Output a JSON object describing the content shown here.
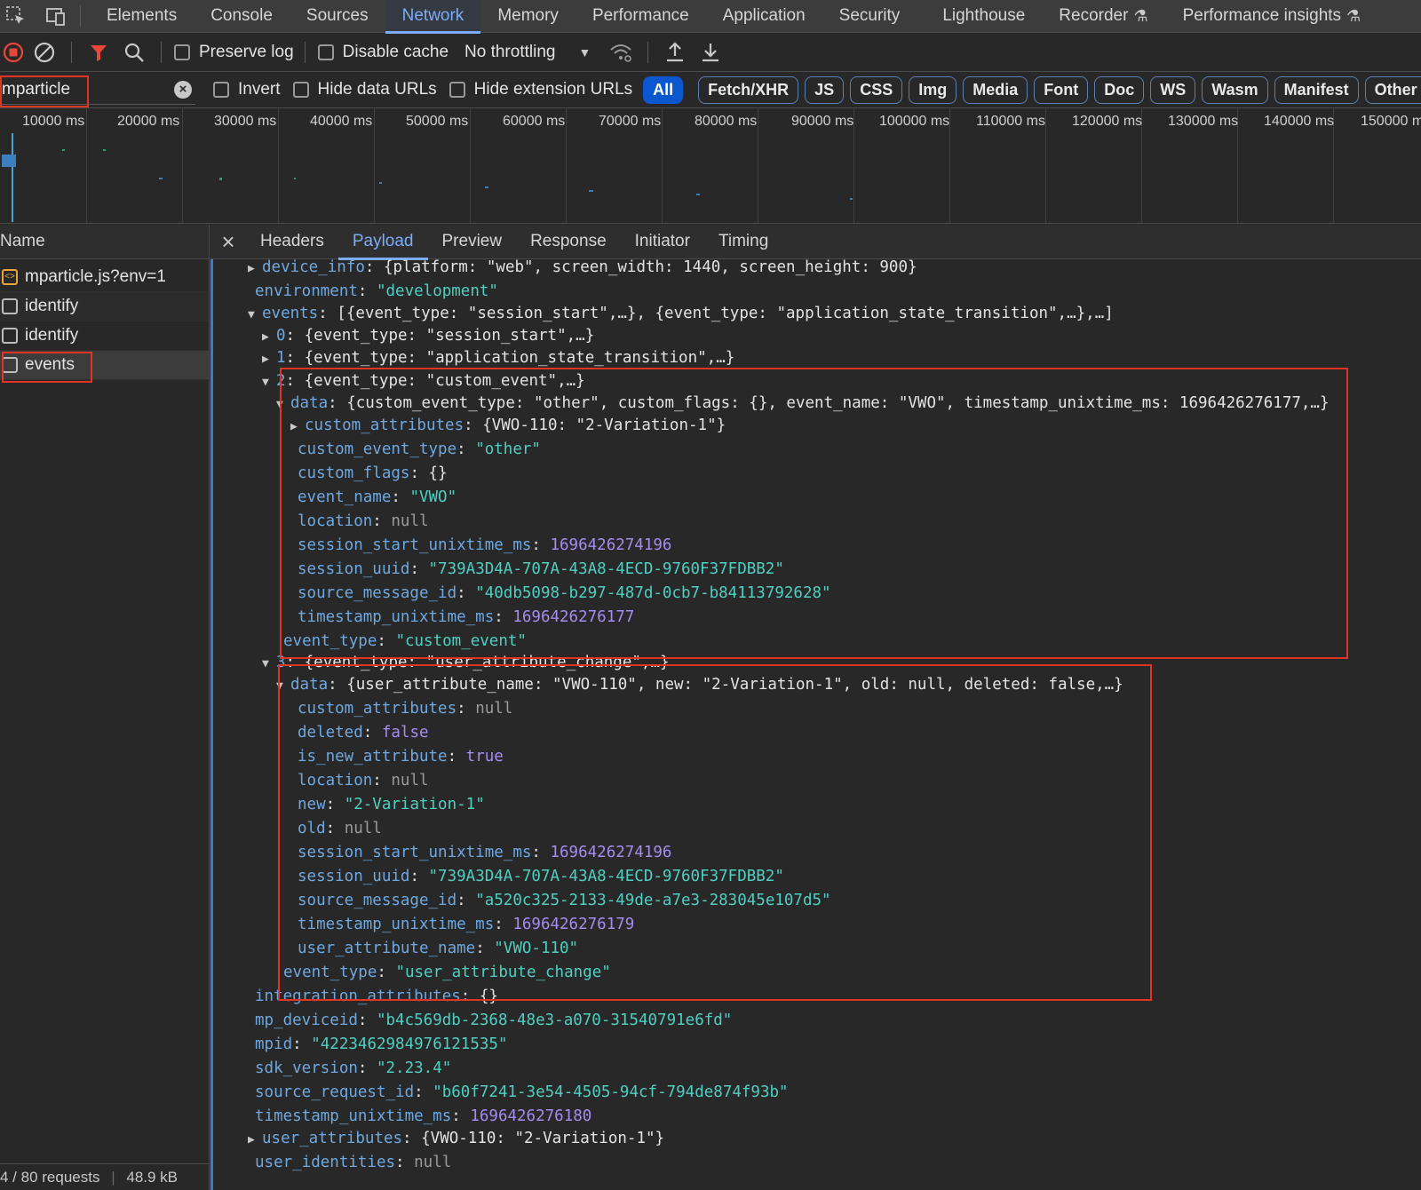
{
  "tabs": [
    "Elements",
    "Console",
    "Sources",
    "Network",
    "Memory",
    "Performance",
    "Application",
    "Security",
    "Lighthouse",
    "Recorder",
    "Performance insights"
  ],
  "toolbar": {
    "preserve_log": "Preserve log",
    "disable_cache": "Disable cache",
    "throttling": "No throttling"
  },
  "filter": {
    "value": "mparticle",
    "invert": "Invert",
    "hide_data_urls": "Hide data URLs",
    "hide_extension_urls": "Hide extension URLs",
    "types": [
      "All",
      "Fetch/XHR",
      "JS",
      "CSS",
      "Img",
      "Media",
      "Font",
      "Doc",
      "WS",
      "Wasm",
      "Manifest",
      "Other"
    ]
  },
  "timeline": {
    "labels": [
      "10000 ms",
      "20000 ms",
      "30000 ms",
      "40000 ms",
      "50000 ms",
      "60000 ms",
      "70000 ms",
      "80000 ms",
      "90000 ms",
      "100000 ms",
      "110000 ms",
      "120000 ms",
      "130000 ms",
      "140000 ms",
      "150000 m"
    ]
  },
  "requests": {
    "header": "Name",
    "items": [
      "mparticle.js?env=1",
      "identify",
      "identify",
      "events"
    ],
    "status_requests": "4 / 80 requests",
    "status_size": "48.9 kB"
  },
  "detail_tabs": [
    "Headers",
    "Payload",
    "Preview",
    "Response",
    "Initiator",
    "Timing"
  ],
  "payload": {
    "device_info": "{platform: \"web\", screen_width: 1440, screen_height: 900}",
    "environment": "\"development\"",
    "events_summary": "[{event_type: \"session_start\",…}, {event_type: \"application_state_transition\",…},…]",
    "e0": "{event_type: \"session_start\",…}",
    "e1": "{event_type: \"application_state_transition\",…}",
    "e2": "{event_type: \"custom_event\",…}",
    "e2_data": "{custom_event_type: \"other\", custom_flags: {}, event_name: \"VWO\", timestamp_unixtime_ms: 1696426276177,…}",
    "e2_custom_attributes": "{VWO-110: \"2-Variation-1\"}",
    "e2_custom_event_type": "\"other\"",
    "e2_custom_flags": "{}",
    "e2_event_name": "\"VWO\"",
    "e2_location": "null",
    "e2_session_start": "1696426274196",
    "e2_session_uuid": "\"739A3D4A-707A-43A8-4ECD-9760F37FDBB2\"",
    "e2_source_message_id": "\"40db5098-b297-487d-0cb7-b84113792628\"",
    "e2_timestamp": "1696426276177",
    "e2_event_type": "\"custom_event\"",
    "e3": "{event_type: \"user_attribute_change\",…}",
    "e3_data": "{user_attribute_name: \"VWO-110\", new: \"2-Variation-1\", old: null, deleted: false,…}",
    "e3_custom_attributes": "null",
    "e3_deleted": "false",
    "e3_is_new_attribute": "true",
    "e3_location": "null",
    "e3_new": "\"2-Variation-1\"",
    "e3_old": "null",
    "e3_session_start": "1696426274196",
    "e3_session_uuid": "\"739A3D4A-707A-43A8-4ECD-9760F37FDBB2\"",
    "e3_source_message_id": "\"a520c325-2133-49de-a7e3-283045e107d5\"",
    "e3_timestamp": "1696426276179",
    "e3_user_attribute_name": "\"VWO-110\"",
    "e3_event_type": "\"user_attribute_change\"",
    "integration_attributes": "{}",
    "mp_deviceid": "\"b4c569db-2368-48e3-a070-31540791e6fd\"",
    "mpid": "\"4223462984976121535\"",
    "sdk_version": "\"2.23.4\"",
    "source_request_id": "\"b60f7241-3e54-4505-94cf-794de874f93b\"",
    "timestamp_unixtime_ms": "1696426276180",
    "user_attributes": "{VWO-110: \"2-Variation-1\"}",
    "user_identities": "null"
  },
  "colors": {
    "accent": "#7cacf8",
    "highlight_box": "#e03524",
    "key": "#6fa8e0",
    "string": "#4fcfc2",
    "number": "#a58cf0"
  }
}
